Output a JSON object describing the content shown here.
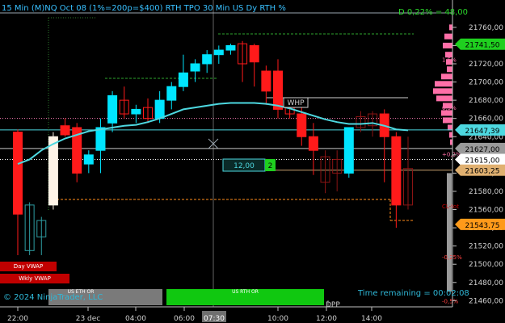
{
  "header": {
    "title": "15 Min (M)NQ Oct 08 (1%=200p=$400)   RTH TPO 30 Min  US Dy RTH %",
    "daily_change": "D 0,22% = 48,00"
  },
  "colors": {
    "background": "#000000",
    "up_candle": "#00e5ff",
    "down_candle": "#ff1a1a",
    "up_hollow": "#2e9ea3",
    "down_hollow": "#8b1414",
    "vwap": "#4dd8e0",
    "profile": "#ff6fa8",
    "orange_line": "#ff8c1a",
    "green_badge": "#1fcf1f",
    "price_grey": "#d8d8d8",
    "label_red": "#cc0000"
  },
  "x_axis": {
    "ticks": [
      "22:00",
      "23 dec",
      "04:00",
      "06:00",
      "07:30",
      "10:00",
      "12:00",
      "14:00"
    ],
    "cursor_label": "07:30"
  },
  "y_axis": {
    "min": 21455,
    "max": 21790,
    "ticks": [
      21760,
      21740,
      21720,
      21700,
      21680,
      21660,
      21640,
      21620,
      21600,
      21580,
      21560,
      21540,
      21520,
      21500,
      21480,
      21460
    ],
    "tick_labels": [
      "21760,00",
      "21740,00",
      "21720,00",
      "21700,00",
      "21680,00",
      "21660,00",
      "21640,00",
      "21620,00",
      "21600,00",
      "21580,00",
      "21560,00",
      "21540,00",
      "21520,00",
      "21500,00",
      "21480,00",
      "21460,00"
    ]
  },
  "price_badges": [
    {
      "label": "21741,50",
      "value": 21741.5,
      "style": "green"
    },
    {
      "label": "21647,39",
      "value": 21647.39,
      "style": "cyan"
    },
    {
      "label": "21627,00",
      "value": 21627.0,
      "style": "grey"
    },
    {
      "label": "21615,00",
      "value": 21615.0,
      "style": "white"
    },
    {
      "label": "21603,25",
      "value": 21603.25,
      "style": "tan"
    },
    {
      "label": "21543,75",
      "value": 21543.75,
      "style": "orange"
    }
  ],
  "profile_labels": [
    {
      "text": "1,5%",
      "value": 21725
    },
    {
      "text": "0,5%",
      "value": 21672
    },
    {
      "text": "+0,2%",
      "value": 21621
    },
    {
      "text": "CL-tot",
      "value": 21564
    },
    {
      "text": "-0,25%",
      "value": 21508
    },
    {
      "text": "-0,5%",
      "value": 21460
    }
  ],
  "overlays": {
    "whp_label": "WHP",
    "box_value": "12,00",
    "box_badge": "2",
    "dpp_label": "DPP",
    "day_vwap": "Day VWAP",
    "wkly_vwap": "Wkly VWAP",
    "eth_label": "US ETH OR",
    "rth_label": "US RTH OR",
    "copyright": "© 2024 NinjaTrader, LLC",
    "time_remaining": "Time remaining = 00:02:08"
  },
  "chart_data": {
    "type": "candlestick",
    "y_unit": "price",
    "candles": [
      {
        "o": 21645,
        "h": 21648,
        "l": 21510,
        "c": 21555
      },
      {
        "o": 21515,
        "h": 21568,
        "l": 21510,
        "c": 21565
      },
      {
        "o": 21530,
        "h": 21552,
        "l": 21510,
        "c": 21548
      },
      {
        "o": 21565,
        "h": 21645,
        "l": 21560,
        "c": 21640
      },
      {
        "o": 21652,
        "h": 21660,
        "l": 21640,
        "c": 21642
      },
      {
        "o": 21650,
        "h": 21655,
        "l": 21590,
        "c": 21600
      },
      {
        "o": 21610,
        "h": 21625,
        "l": 21600,
        "c": 21620
      },
      {
        "o": 21625,
        "h": 21660,
        "l": 21600,
        "c": 21650
      },
      {
        "o": 21655,
        "h": 21690,
        "l": 21645,
        "c": 21685
      },
      {
        "o": 21680,
        "h": 21695,
        "l": 21660,
        "c": 21665
      },
      {
        "o": 21665,
        "h": 21675,
        "l": 21655,
        "c": 21670
      },
      {
        "o": 21672,
        "h": 21682,
        "l": 21655,
        "c": 21660
      },
      {
        "o": 21660,
        "h": 21690,
        "l": 21655,
        "c": 21680
      },
      {
        "o": 21680,
        "h": 21700,
        "l": 21670,
        "c": 21695
      },
      {
        "o": 21695,
        "h": 21730,
        "l": 21690,
        "c": 21710
      },
      {
        "o": 21712,
        "h": 21725,
        "l": 21700,
        "c": 21720
      },
      {
        "o": 21720,
        "h": 21735,
        "l": 21710,
        "c": 21730
      },
      {
        "o": 21730,
        "h": 21740,
        "l": 21720,
        "c": 21735
      },
      {
        "o": 21735,
        "h": 21742,
        "l": 21730,
        "c": 21740
      },
      {
        "o": 21742,
        "h": 21745,
        "l": 21700,
        "c": 21720
      },
      {
        "o": 21740,
        "h": 21742,
        "l": 21695,
        "c": 21722
      },
      {
        "o": 21712,
        "h": 21718,
        "l": 21675,
        "c": 21690
      },
      {
        "o": 21712,
        "h": 21725,
        "l": 21660,
        "c": 21670
      },
      {
        "o": 21672,
        "h": 21680,
        "l": 21660,
        "c": 21665
      },
      {
        "o": 21665,
        "h": 21675,
        "l": 21630,
        "c": 21640
      },
      {
        "o": 21640,
        "h": 21655,
        "l": 21598,
        "c": 21625
      },
      {
        "o": 21618,
        "h": 21625,
        "l": 21578,
        "c": 21590
      },
      {
        "o": 21615,
        "h": 21625,
        "l": 21580,
        "c": 21600
      },
      {
        "o": 21600,
        "h": 21620,
        "l": 21595,
        "c": 21650
      },
      {
        "o": 21650,
        "h": 21668,
        "l": 21645,
        "c": 21662
      },
      {
        "o": 21665,
        "h": 21668,
        "l": 21640,
        "c": 21652
      },
      {
        "o": 21665,
        "h": 21670,
        "l": 21590,
        "c": 21640
      },
      {
        "o": 21640,
        "h": 21645,
        "l": 21540,
        "c": 21565
      },
      {
        "o": 21565,
        "h": 21640,
        "l": 21560,
        "c": 21605
      }
    ],
    "vwap": [
      21610,
      21615,
      21625,
      21632,
      21638,
      21642,
      21646,
      21648,
      21650,
      21652,
      21653,
      21656,
      21660,
      21665,
      21670,
      21672,
      21674,
      21676,
      21677,
      21677,
      21677,
      21676,
      21674,
      21671,
      21667,
      21663,
      21659,
      21656,
      21654,
      21654,
      21655,
      21652,
      21648,
      21647
    ]
  }
}
